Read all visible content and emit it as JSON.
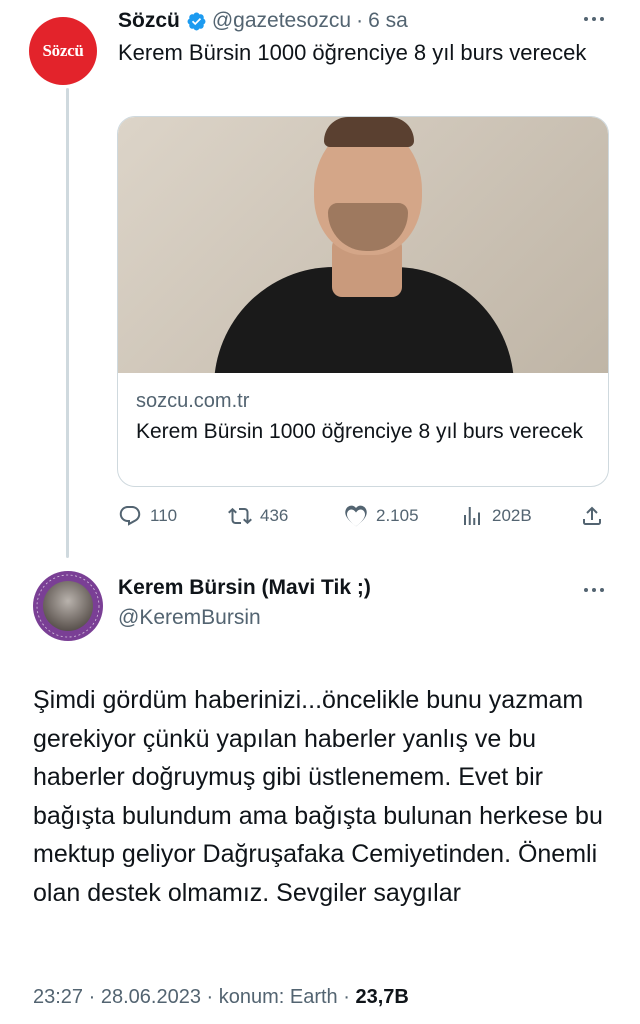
{
  "quoted_tweet": {
    "avatar_text": "Sözcü",
    "author_name": "Sözcü",
    "handle": "@gazetesozcu",
    "separator": "·",
    "time": "6 sa",
    "text": "Kerem Bürsin 1000 öğrenciye 8 yıl burs verecek",
    "card": {
      "domain": "sozcu.com.tr",
      "title": "Kerem Bürsin 1000 öğrenciye 8 yıl burs verecek"
    },
    "actions": {
      "replies": "110",
      "retweets": "436",
      "likes": "2.105",
      "views": "202B"
    }
  },
  "main_tweet": {
    "author_name": "Kerem Bürsin (Mavi Tik ;)",
    "handle": "@KeremBursin",
    "text": "Şimdi gördüm haberinizi...öncelikle bunu yazmam gerekiyor çünkü yapılan haberler yanlış ve bu haberler doğruymuş gibi üstlenemem. Evet bir bağışta bulundum ama bağışta bulunan herkese bu mektup geliyor Dağruşafaka Cemiyetinden. Önemli olan destek olmamız. Sevgiler saygılar",
    "meta": {
      "time": "23:27",
      "date": "28.06.2023",
      "location": "konum: Earth",
      "views": "23,7B"
    }
  },
  "colors": {
    "brand_red": "#e3232b",
    "verified_blue": "#1d9bf0",
    "muted_text": "#536471",
    "avatar_purple": "#7a3f95"
  }
}
